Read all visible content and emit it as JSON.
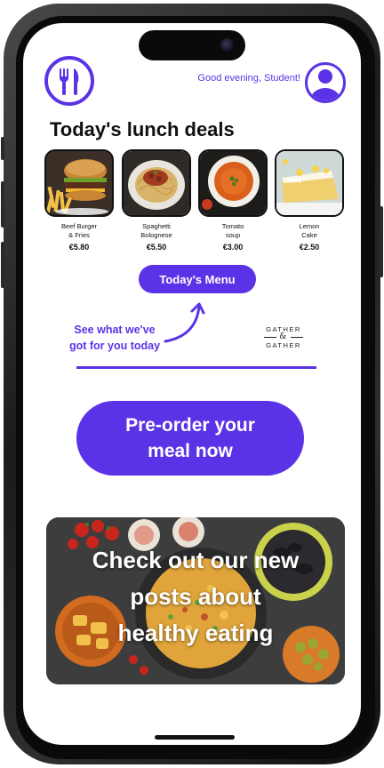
{
  "header": {
    "greeting": "Good evening, Student!"
  },
  "deals": {
    "title": "Today's lunch deals",
    "items": [
      {
        "name_line1": "Beef Burger",
        "name_line2": "& Fries",
        "price": "€5.80",
        "image": "burger-fries"
      },
      {
        "name_line1": "Spaghetti",
        "name_line2": "Bolognese",
        "price": "€5.50",
        "image": "spaghetti"
      },
      {
        "name_line1": "Tomato",
        "name_line2": "soup",
        "price": "€3.00",
        "image": "tomato-soup"
      },
      {
        "name_line1": "Lemon",
        "name_line2": "Cake",
        "price": "€2.50",
        "image": "lemon-cake"
      }
    ]
  },
  "menu_button": {
    "label": "Today's Menu"
  },
  "promo": {
    "line1": "See what we've",
    "line2": "got for you today"
  },
  "brand": {
    "line1": "GATHER",
    "amp": "&",
    "line2": "GATHER"
  },
  "preorder": {
    "line1": "Pre-order your",
    "line2": "meal now"
  },
  "banner": {
    "line1": "Check out our new",
    "line2": "posts about",
    "line3": "healthy eating"
  },
  "colors": {
    "accent": "#5b33e6",
    "text": "#111111"
  }
}
